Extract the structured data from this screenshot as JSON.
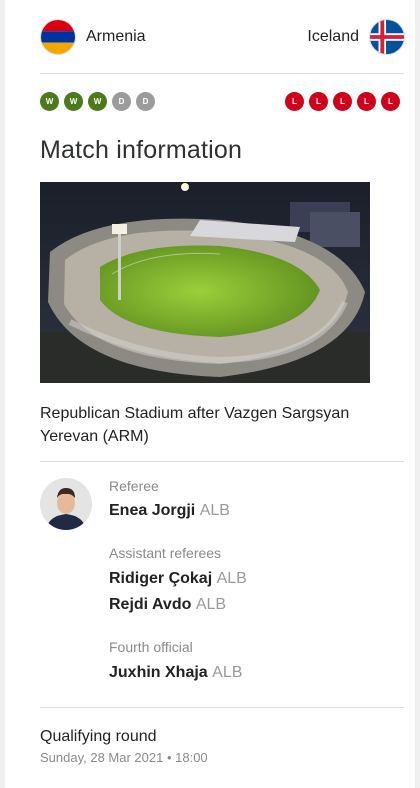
{
  "match": {
    "home": {
      "name": "Armenia",
      "flag_icon": "armenia-flag-icon",
      "form": [
        "W",
        "W",
        "W",
        "D",
        "D"
      ]
    },
    "away": {
      "name": "Iceland",
      "flag_icon": "iceland-flag-icon",
      "form": [
        "L",
        "L",
        "L",
        "L",
        "L"
      ]
    }
  },
  "colors": {
    "win": "#4c7a1d",
    "draw": "#9b9b9b",
    "loss": "#d0021b"
  },
  "info": {
    "title": "Match information",
    "venue": {
      "name": "Republican Stadium after Vazgen Sargsyan",
      "city": "Yerevan (ARM)"
    },
    "officials": {
      "referee_label": "Referee",
      "referee": {
        "name": "Enea Jorgji",
        "nat": "ALB"
      },
      "assistants_label": "Assistant referees",
      "assistants": [
        {
          "name": "Ridiger Çokaj",
          "nat": "ALB"
        },
        {
          "name": "Rejdi Avdo",
          "nat": "ALB"
        }
      ],
      "fourth_label": "Fourth official",
      "fourth": {
        "name": "Juxhin Xhaja",
        "nat": "ALB"
      }
    },
    "round": "Qualifying round",
    "datetime": "Sunday, 28 Mar 2021 • 18:00"
  }
}
